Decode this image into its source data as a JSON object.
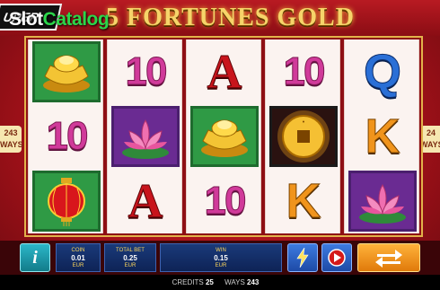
{
  "header": {
    "game_title": "5 FORTUNES GOLD",
    "brand_badge": "UPER",
    "watermark_main": "Slot",
    "watermark_accent": "Catalog"
  },
  "ways_side_left": {
    "number": "243",
    "label": "WAYS"
  },
  "ways_side_right": {
    "number": "24",
    "label": "WAYS"
  },
  "reels": [
    {
      "symbols": [
        {
          "kind": "ingot",
          "name": "gold-ingot-icon"
        },
        {
          "kind": "ten",
          "text": "10"
        },
        {
          "kind": "lantern",
          "name": "red-lantern-icon"
        }
      ]
    },
    {
      "symbols": [
        {
          "kind": "ten",
          "text": "10"
        },
        {
          "kind": "lotus",
          "name": "pink-lotus-icon"
        },
        {
          "kind": "a",
          "text": "A"
        }
      ]
    },
    {
      "symbols": [
        {
          "kind": "a",
          "text": "A"
        },
        {
          "kind": "ingot",
          "name": "gold-ingot-icon"
        },
        {
          "kind": "ten",
          "text": "10"
        }
      ]
    },
    {
      "symbols": [
        {
          "kind": "ten",
          "text": "10"
        },
        {
          "kind": "coin",
          "name": "gold-coin-icon"
        },
        {
          "kind": "k",
          "text": "K"
        }
      ]
    },
    {
      "symbols": [
        {
          "kind": "q",
          "text": "Q"
        },
        {
          "kind": "k",
          "text": "K"
        },
        {
          "kind": "lotus",
          "name": "pink-lotus-icon"
        }
      ]
    }
  ],
  "controls": {
    "info_label": "i",
    "coin_label": "COIN",
    "coin_value": "0.01",
    "coin_currency": "EUR",
    "total_bet_label": "TOTAL BET",
    "total_bet_value": "0.25",
    "total_bet_currency": "EUR",
    "win_label": "WIN",
    "win_value": "0.15",
    "win_currency": "EUR",
    "turbo_icon": "lightning-icon",
    "autoplay_icon": "play-circle-icon",
    "spin_icon": "swap-arrows-icon"
  },
  "footer": {
    "credits_label": "CREDITS",
    "credits_value": "25",
    "ways_label": "WAYS",
    "ways_value": "243"
  },
  "colors": {
    "background": "#b81a22",
    "title_gold": "#f6d46a",
    "reel_bg": "#fbf3f0",
    "spin_orange": "#f09a1e",
    "panel_blue": "#1a3a7a"
  }
}
